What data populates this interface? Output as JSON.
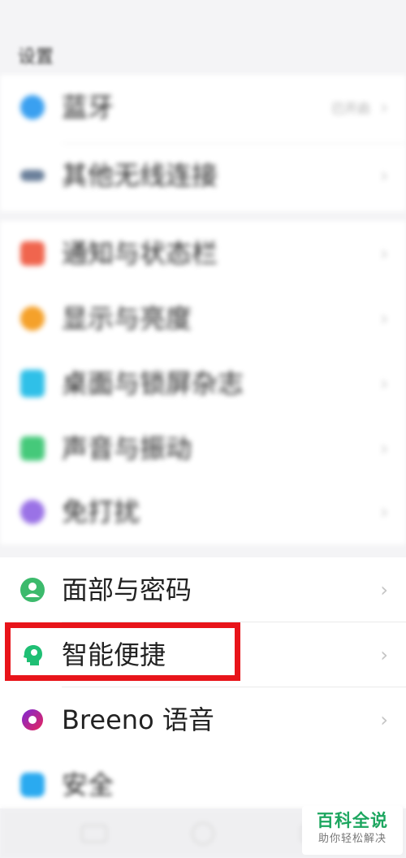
{
  "status_bar": {
    "left": "",
    "right": ""
  },
  "header": {
    "title": "设置"
  },
  "group_connectivity": [
    {
      "label": "蓝牙",
      "value": "已开启",
      "icon": "bluetooth-icon",
      "color": "#3aa0f0"
    },
    {
      "label": "其他无线连接",
      "value": "",
      "icon": "wireless-icon",
      "color": "#6a7f9a"
    }
  ],
  "group_personalization": [
    {
      "label": "通知与状态栏",
      "icon": "notification-icon",
      "color": "#f0654e"
    },
    {
      "label": "显示与亮度",
      "icon": "brightness-icon",
      "color": "#f5a12a"
    },
    {
      "label": "桌面与锁屏杂志",
      "icon": "desktop-icon",
      "color": "#2fc0e8"
    },
    {
      "label": "声音与振动",
      "icon": "sound-icon",
      "color": "#45c97a"
    },
    {
      "label": "免打扰",
      "icon": "moon-icon",
      "color": "#9a72e6"
    }
  ],
  "group_security": [
    {
      "label": "面部与密码",
      "icon": "face-icon",
      "color": "#3cba6c"
    },
    {
      "label": "智能便捷",
      "icon": "smart-head-icon",
      "color": "#1fbf74"
    },
    {
      "label": "Breeno 语音",
      "icon": "breeno-icon",
      "color": "#c01a6c"
    },
    {
      "label": "安全",
      "icon": "security-icon",
      "color": "#2aaaf0"
    }
  ],
  "highlight": {
    "target": "智能便捷",
    "color": "#e8141a"
  },
  "watermark": {
    "title": "百科全说",
    "subtitle": "助你轻松解决"
  }
}
